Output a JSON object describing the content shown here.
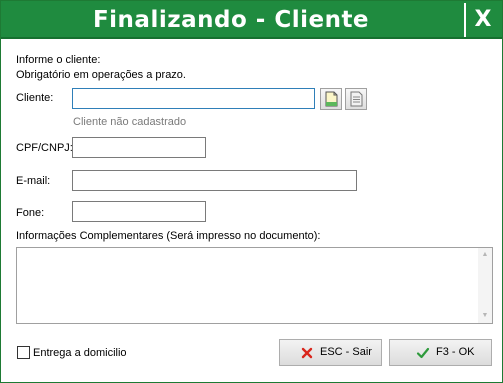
{
  "window": {
    "title": "Finalizando - Cliente",
    "close_label": "X",
    "accent_color": "#1f8b3f"
  },
  "info": {
    "line1": "Informe o cliente:",
    "line2": "Obrigatório em operações a prazo."
  },
  "form": {
    "cliente_label": "Cliente:",
    "cliente_value": "",
    "cliente_status": "Cliente não cadastrado",
    "cpf_label": "CPF/CNPJ:",
    "cpf_value": "",
    "email_label": "E-mail:",
    "email_value": "",
    "fone_label": "Fone:",
    "fone_value": "",
    "info_label": "Informações Complementares (Será impresso no documento):",
    "info_value": ""
  },
  "icons": {
    "new_client": "new-document-icon",
    "search_client": "document-list-icon"
  },
  "footer": {
    "entrega_label": "Entrega a domicilio",
    "entrega_checked": false,
    "esc_label": "ESC - Sair",
    "ok_label": "F3 - OK"
  }
}
